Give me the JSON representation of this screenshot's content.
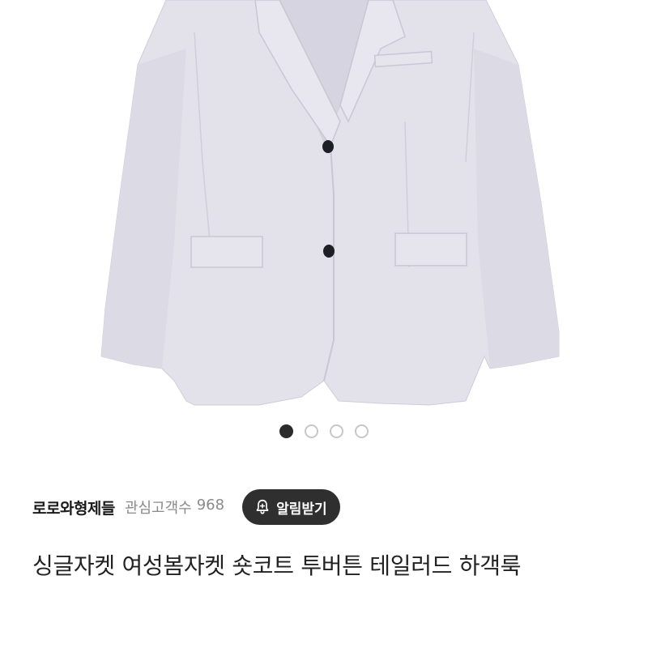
{
  "product_image": {
    "icon": "product-photo-blazer",
    "color": "#e2e0ea"
  },
  "pager": {
    "count": 4,
    "active_index": 0
  },
  "seller": {
    "shop_name": "로로와형제들",
    "follower_label": "관심고객수",
    "follower_count": "968",
    "follow_button_label": "알림받기"
  },
  "product": {
    "title": "싱글자켓 여성봄자켓 숏코트 투버튼 테일러드 하객룩"
  }
}
